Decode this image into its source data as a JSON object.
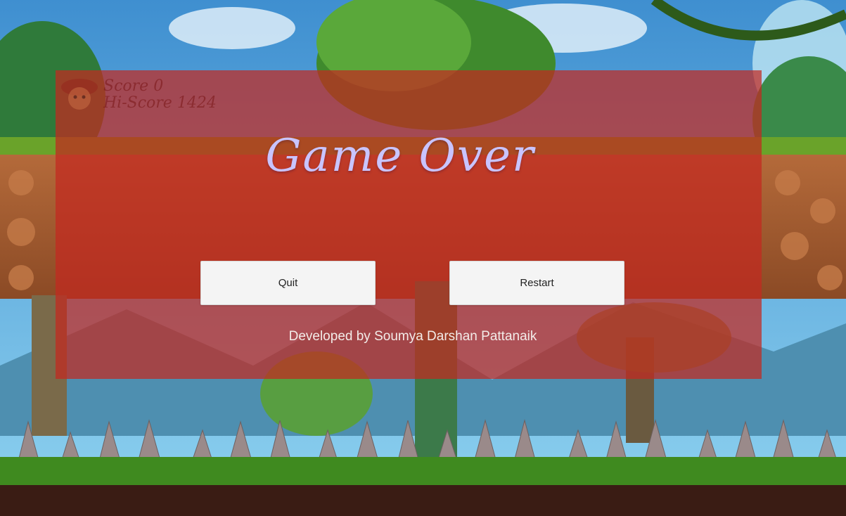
{
  "game": {
    "title": "Game Over",
    "hud": {
      "score_label": "Score",
      "score_value": "0",
      "hiscore_label": "Hi-Score",
      "hiscore_value": "1424",
      "avatar_icon": "character-avatar-icon"
    },
    "buttons": {
      "quit": "Quit",
      "restart": "Restart"
    },
    "credit": "Developed by Soumya Darshan Pattanaik",
    "colors": {
      "overlay": "#c42820",
      "title": "#c9c4ff",
      "button_bg": "#f4f4f4"
    }
  }
}
